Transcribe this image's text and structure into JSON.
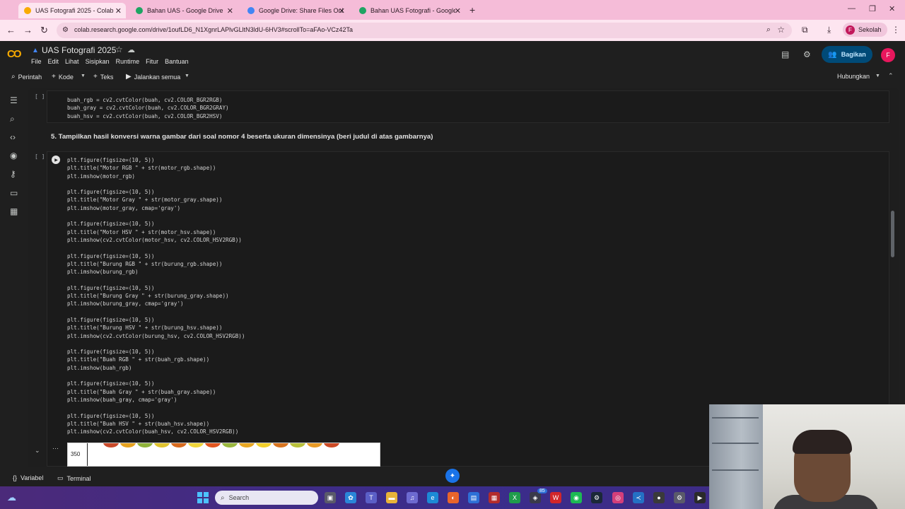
{
  "browser": {
    "tabs": [
      {
        "label": "UAS Fotografi 2025 - Colab",
        "active": true,
        "favicon_color": "#f9ab00"
      },
      {
        "label": "Bahan UAS - Google Drive",
        "active": false,
        "favicon_color": "#1fa463"
      },
      {
        "label": "Google Drive: Share Files Online",
        "active": false,
        "favicon_color": "#4285f4"
      },
      {
        "label": "Bahan UAS Fotografi - Google D",
        "active": false,
        "favicon_color": "#1fa463"
      }
    ],
    "url": "colab.research.google.com/drive/1oufLD6_N1XgnrLAPlvGLltN3ldU-6HV3#scrollTo=aFAo-VCz42Ta",
    "profile": {
      "initial": "F",
      "label": "Sekolah"
    }
  },
  "colab": {
    "logo_text": "CO",
    "notebook_title": "UAS Fotografi 2025",
    "menu": [
      "File",
      "Edit",
      "Lihat",
      "Sisipkan",
      "Runtime",
      "Fitur",
      "Bantuan"
    ],
    "share_label": "Bagikan",
    "user_initial": "F",
    "toolbar": {
      "command": "Perintah",
      "code": "Kode",
      "text": "Teks",
      "run_all": "Jalankan semua",
      "connect": "Hubungkan"
    }
  },
  "cells": {
    "first_bracket": "[ ]",
    "first_code": [
      "buah_rgb = cv2.cvtColor(buah, cv2.COLOR_BGR2RGB)",
      "buah_gray = cv2.cvtColor(buah, cv2.COLOR_BGR2GRAY)",
      "buah_hsv = cv2.cvtColor(buah, cv2.COLOR_BGR2HSV)"
    ],
    "heading": "5. Tampilkan hasil konversi warna gambar dari soal nomor 4 beserta ukuran dimensinya (beri judul di atas gambarnya)",
    "second_bracket": "[ ]",
    "second_code": [
      "plt.figure(figsize=(10, 5))",
      "plt.title(\"Motor RGB \" + str(motor_rgb.shape))",
      "plt.imshow(motor_rgb)",
      "",
      "plt.figure(figsize=(10, 5))",
      "plt.title(\"Motor Gray \" + str(motor_gray.shape))",
      "plt.imshow(motor_gray, cmap='gray')",
      "",
      "plt.figure(figsize=(10, 5))",
      "plt.title(\"Motor HSV \" + str(motor_hsv.shape))",
      "plt.imshow(cv2.cvtColor(motor_hsv, cv2.COLOR_HSV2RGB))",
      "",
      "plt.figure(figsize=(10, 5))",
      "plt.title(\"Burung RGB \" + str(burung_rgb.shape))",
      "plt.imshow(burung_rgb)",
      "",
      "plt.figure(figsize=(10, 5))",
      "plt.title(\"Burung Gray \" + str(burung_gray.shape))",
      "plt.imshow(burung_gray, cmap='gray')",
      "",
      "plt.figure(figsize=(10, 5))",
      "plt.title(\"Burung HSV \" + str(burung_hsv.shape))",
      "plt.imshow(cv2.cvtColor(burung_hsv, cv2.COLOR_HSV2RGB))",
      "",
      "plt.figure(figsize=(10, 5))",
      "plt.title(\"Buah RGB \" + str(buah_rgb.shape))",
      "plt.imshow(buah_rgb)",
      "",
      "plt.figure(figsize=(10, 5))",
      "plt.title(\"Buah Gray \" + str(buah_gray.shape))",
      "plt.imshow(buah_gray, cmap='gray')",
      "",
      "plt.figure(figsize=(10, 5))",
      "plt.title(\"Buah HSV \" + str(buah_hsv.shape))",
      "plt.imshow(cv2.cvtColor(buah_hsv, cv2.COLOR_HSV2RGB))"
    ],
    "output_ytick": "350",
    "output_menu": "⋯"
  },
  "status_bar": {
    "variables": "Variabel",
    "terminal": "Terminal"
  },
  "taskbar": {
    "search_placeholder": "Search",
    "badge_count": "85"
  },
  "icons": {
    "back": "back-arrow-icon",
    "forward": "forward-arrow-icon",
    "reload": "reload-icon",
    "run": "play-icon",
    "gemini": "gemini-icon"
  }
}
